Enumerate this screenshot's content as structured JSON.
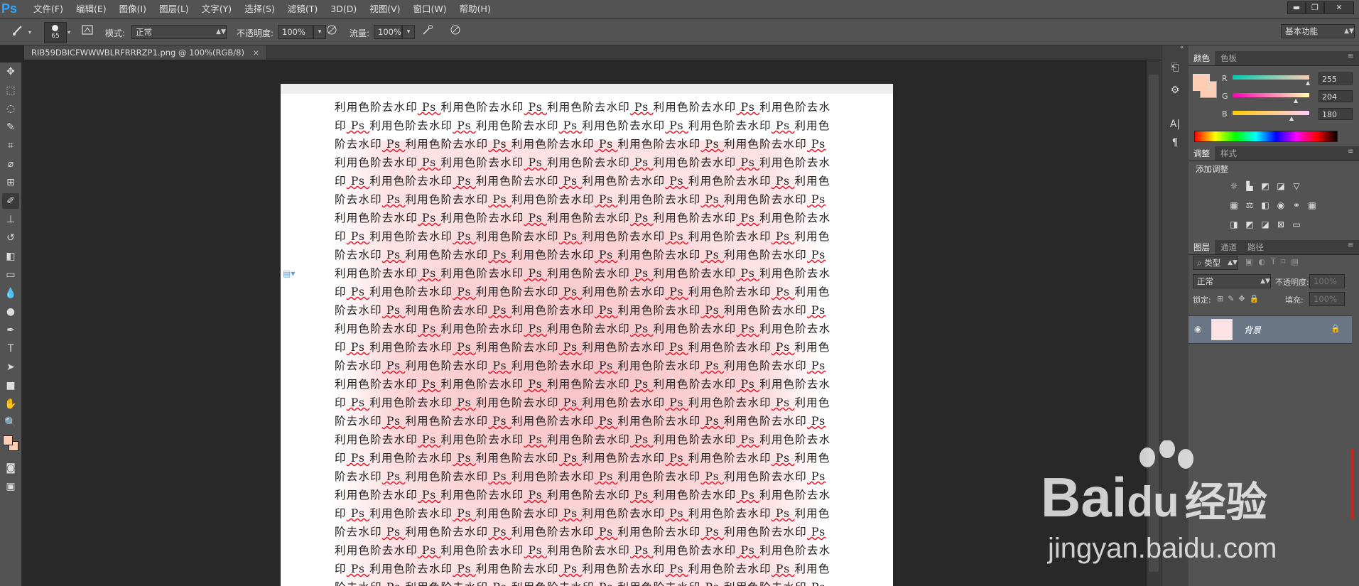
{
  "app": {
    "logo": "Ps"
  },
  "menu": [
    "文件(F)",
    "编辑(E)",
    "图像(I)",
    "图层(L)",
    "文字(Y)",
    "选择(S)",
    "滤镜(T)",
    "3D(D)",
    "视图(V)",
    "窗口(W)",
    "帮助(H)"
  ],
  "window_controls": {
    "minimize": "▬",
    "restore": "❐",
    "close": "✕"
  },
  "options": {
    "brush_size": "65",
    "mode_label": "模式:",
    "mode_value": "正常",
    "opacity_label": "不透明度:",
    "opacity_value": "100%",
    "flow_label": "流量:",
    "flow_value": "100%",
    "workspace": "基本功能"
  },
  "document_tab": {
    "title": "RIB59DBICFWWWBLRFRRRZP1.png @ 100%(RGB/8)",
    "close": "×"
  },
  "document": {
    "repeat_text": "利用色阶去水印",
    "ps_word": "Ps"
  },
  "color_panel": {
    "tabs": [
      "颜色",
      "色板"
    ],
    "r_label": "R",
    "r_value": "255",
    "g_label": "G",
    "g_value": "204",
    "b_label": "B",
    "b_value": "180",
    "foreground_color": "#ffccb4"
  },
  "adjust_panel": {
    "tabs": [
      "调整",
      "样式"
    ],
    "add_label": "添加调整"
  },
  "layers_panel": {
    "tabs": [
      "图层",
      "通道",
      "路径"
    ],
    "filter_label": "类型",
    "blend_mode": "正常",
    "opacity_label": "不透明度:",
    "opacity_value": "100%",
    "lock_label": "锁定:",
    "fill_label": "填充:",
    "fill_value": "100%",
    "layer_name": "背景"
  },
  "watermark": {
    "brand": "Bai",
    "brand_du": "du",
    "cn": "经验",
    "url": "jingyan.baidu.com"
  },
  "colors": {
    "fg": "#ffccb4",
    "bg": "#ffffff",
    "accent_blue": "#31a8ff"
  }
}
